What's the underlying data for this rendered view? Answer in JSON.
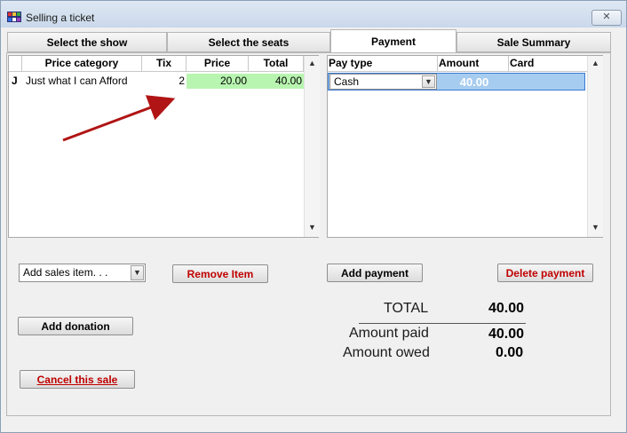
{
  "window": {
    "title": "Selling a ticket",
    "close_glyph": "✕"
  },
  "tabs": [
    {
      "label": "Select the show"
    },
    {
      "label": "Select the seats"
    },
    {
      "label": "Payment",
      "active": true
    },
    {
      "label": "Sale Summary"
    }
  ],
  "items_grid": {
    "columns": [
      "",
      "Price category",
      "Tix",
      "Price",
      "Total"
    ],
    "rows": [
      {
        "marker": "J",
        "category": "Just what I can Afford",
        "tix": "2",
        "price": "20.00",
        "total": "40.00"
      }
    ]
  },
  "payments_grid": {
    "columns": [
      "Pay type",
      "Amount",
      "Card"
    ],
    "rows": [
      {
        "pay_type": "Cash",
        "amount": "40.00",
        "card": ""
      }
    ]
  },
  "buttons": {
    "add_sales_item": "Add sales item. . .",
    "remove_item": "Remove Item",
    "add_payment": "Add payment",
    "delete_payment": "Delete payment",
    "add_donation": "Add donation",
    "cancel_sale": "Cancel this sale"
  },
  "summary": {
    "total_label": "TOTAL",
    "total_value": "40.00",
    "paid_label": "Amount paid",
    "paid_value": "40.00",
    "owed_label": "Amount owed",
    "owed_value": "0.00"
  },
  "icons": {
    "app": "app-icon",
    "close": "close-icon",
    "scroll_up": "▲",
    "scroll_down": "▼",
    "dropdown": "▼"
  },
  "colors": {
    "price_cell_bg": "#b8f5b0",
    "selected_row_bg": "#a6ccef",
    "danger_text": "#c00000",
    "arrow": "#b01414"
  }
}
